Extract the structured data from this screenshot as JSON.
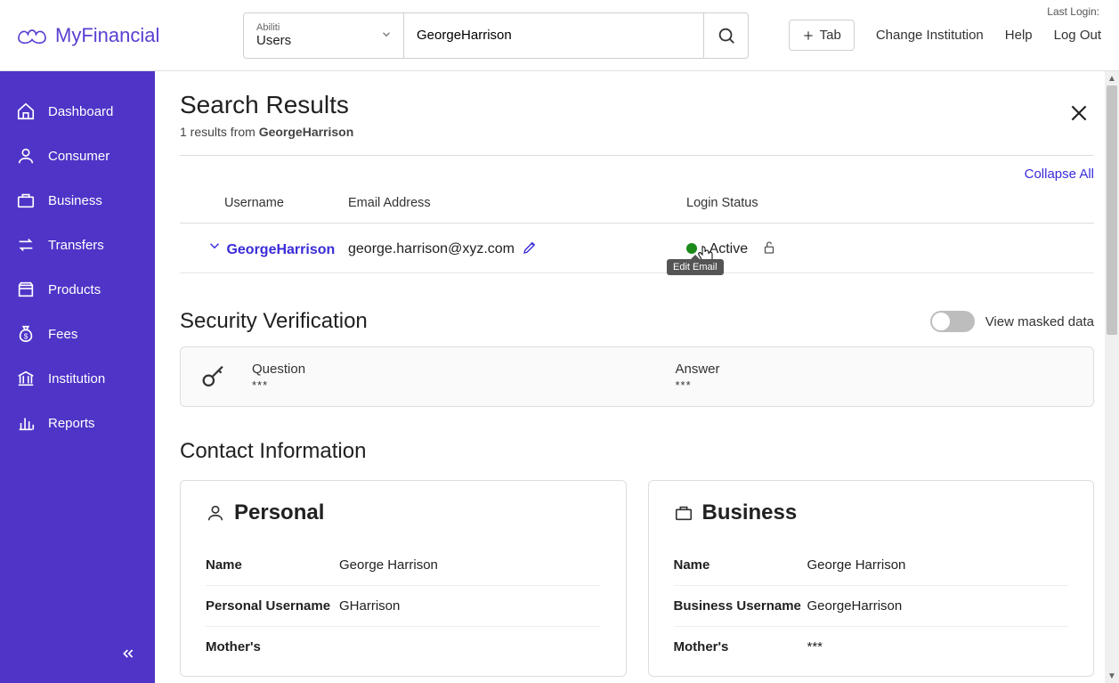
{
  "brand": "MyFinancial",
  "header": {
    "scope_small": "Abiliti",
    "scope_big": "Users",
    "search_value": "GeorgeHarrison",
    "tab_label": "Tab",
    "change_inst": "Change Institution",
    "help": "Help",
    "logout": "Log Out",
    "last_login_label": "Last Login:"
  },
  "sidebar": {
    "items": [
      {
        "label": "Dashboard"
      },
      {
        "label": "Consumer"
      },
      {
        "label": "Business"
      },
      {
        "label": "Transfers"
      },
      {
        "label": "Products"
      },
      {
        "label": "Fees"
      },
      {
        "label": "Institution"
      },
      {
        "label": "Reports"
      }
    ]
  },
  "results": {
    "title": "Search Results",
    "count_text": "1 results from ",
    "query": "GeorgeHarrison",
    "collapse_all": "Collapse All",
    "columns": {
      "user": "Username",
      "email": "Email Address",
      "login": "Login Status"
    },
    "row": {
      "username": "GeorgeHarrison",
      "email": "george.harrison@xyz.com",
      "status": "Active",
      "tooltip": "Edit Email"
    }
  },
  "security": {
    "title": "Security Verification",
    "mask_label": "View masked data",
    "question_label": "Question",
    "question_value": "***",
    "answer_label": "Answer",
    "answer_value": "***"
  },
  "contact": {
    "title": "Contact Information",
    "personal": {
      "heading": "Personal",
      "name_label": "Name",
      "name_value": "George Harrison",
      "user_label": "Personal Username",
      "user_value": "GHarrison",
      "mother_label": "Mother's"
    },
    "business": {
      "heading": "Business",
      "name_label": "Name",
      "name_value": "George Harrison",
      "user_label": "Business Username",
      "user_value": "GeorgeHarrison",
      "mother_label": "Mother's",
      "mother_value": "***"
    }
  }
}
